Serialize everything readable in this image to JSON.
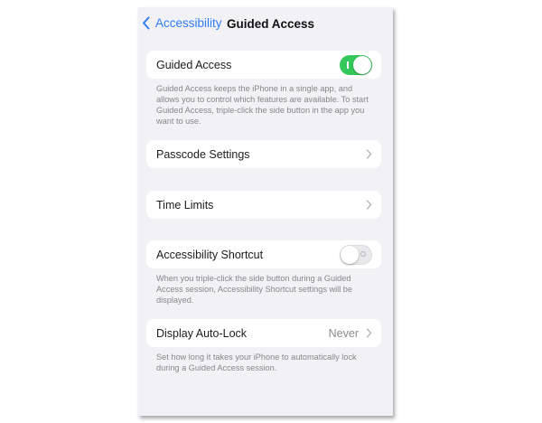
{
  "nav": {
    "back_label": "Accessibility",
    "title": "Guided Access"
  },
  "guided_access": {
    "label": "Guided Access",
    "enabled": true,
    "footer": "Guided Access keeps the iPhone in a single app, and allows you to control which features are available. To start Guided Access, triple-click the side button in the app you want to use."
  },
  "passcode_settings": {
    "label": "Passcode Settings"
  },
  "time_limits": {
    "label": "Time Limits"
  },
  "accessibility_shortcut": {
    "label": "Accessibility Shortcut",
    "enabled": false,
    "footer": "When you triple-click the side button during a Guided Access session, Accessibility Shortcut settings will be displayed."
  },
  "display_auto_lock": {
    "label": "Display Auto-Lock",
    "value": "Never",
    "footer": "Set how long it takes your iPhone to automatically lock during a Guided Access session."
  },
  "colors": {
    "accent": "#2f7cf6",
    "toggle_on": "#34c759",
    "background": "#f2f2f6"
  },
  "icons": {
    "back": "chevron-left-icon",
    "disclosure": "chevron-right-icon"
  }
}
